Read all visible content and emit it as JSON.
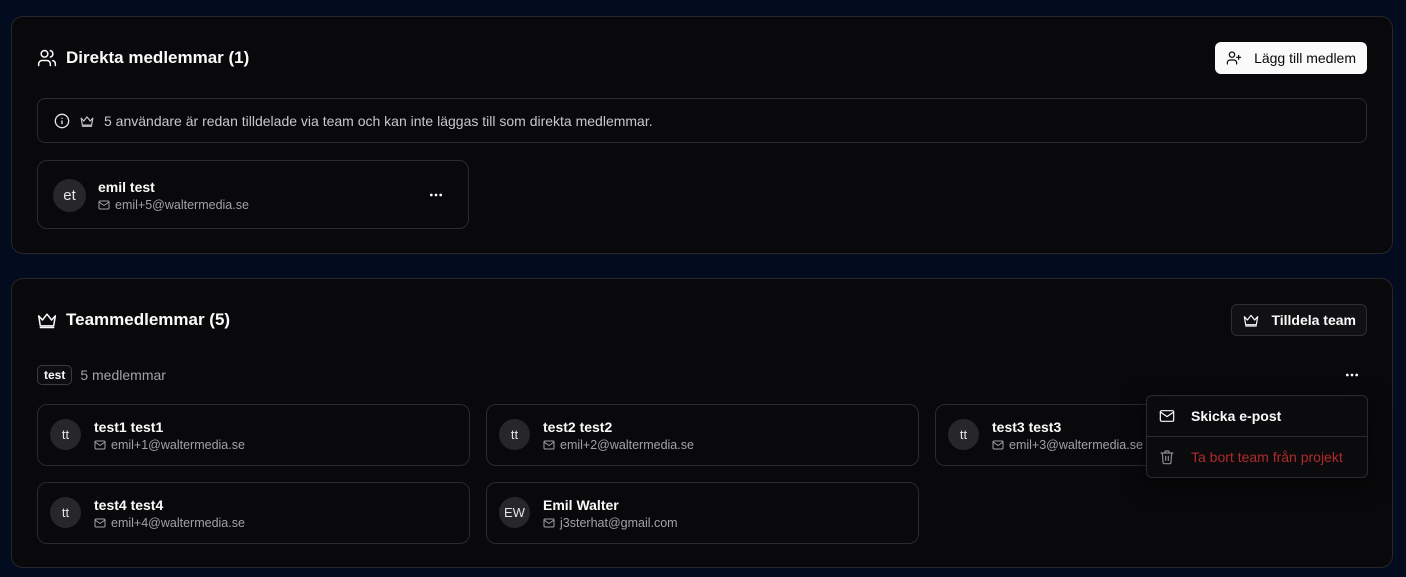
{
  "direct_section": {
    "title": "Direkta medlemmar (1)",
    "add_button_label": "Lägg till medlem",
    "info_text": "5 användare är redan tilldelade via team och kan inte läggas till som direkta medlemmar.",
    "members": [
      {
        "initials": "et",
        "name": "emil test",
        "email": "emil+5@waltermedia.se"
      }
    ]
  },
  "team_section": {
    "title": "Teammedlemmar (5)",
    "assign_button_label": "Tilldela team",
    "team": {
      "name": "test",
      "member_count_label": "5 medlemmar"
    },
    "members": [
      {
        "initials": "tt",
        "name": "test1 test1",
        "email": "emil+1@waltermedia.se"
      },
      {
        "initials": "tt",
        "name": "test2 test2",
        "email": "emil+2@waltermedia.se"
      },
      {
        "initials": "tt",
        "name": "test3 test3",
        "email": "emil+3@waltermedia.se"
      },
      {
        "initials": "tt",
        "name": "test4 test4",
        "email": "emil+4@waltermedia.se"
      },
      {
        "initials": "EW",
        "name": "Emil Walter",
        "email": "j3sterhat@gmail.com"
      }
    ]
  },
  "dropdown_menu": {
    "send_email_label": "Skicka e-post",
    "remove_team_label": "Ta bort team från projekt"
  },
  "icons": {
    "users": "users-icon",
    "user_plus": "user-plus-icon",
    "info": "info-icon",
    "crown": "crown-icon",
    "more": "more-horizontal-icon",
    "mail": "mail-icon",
    "trash": "trash-icon"
  },
  "colors": {
    "page_background": "#030b1f",
    "card_background": "#09090b",
    "border": "#26262b",
    "primary_button": "#fafafa",
    "danger_text": "#b02a2a"
  }
}
